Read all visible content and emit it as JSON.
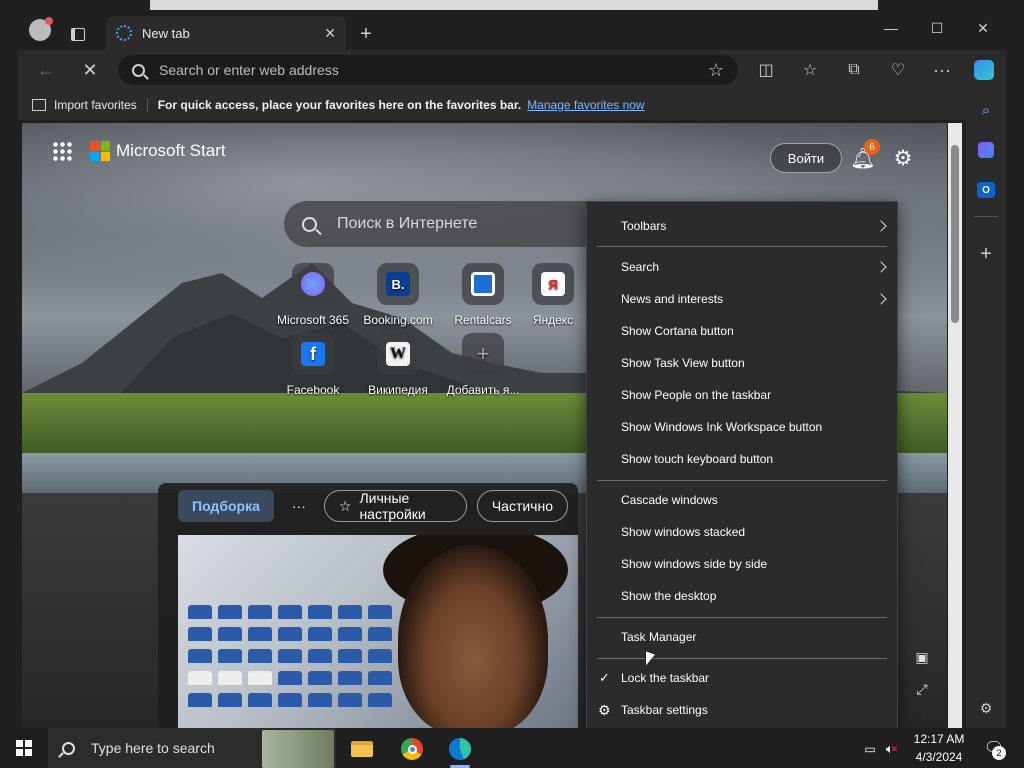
{
  "browser": {
    "tab_title": "New tab",
    "address_placeholder": "Search or enter web address",
    "favbar": {
      "import_label": "Import favorites",
      "hint": "For quick access, place your favorites here on the favorites bar.",
      "manage_link": "Manage favorites now"
    }
  },
  "newtab": {
    "brand": "Microsoft Start",
    "login_label": "Войти",
    "notif_count": "6",
    "search_placeholder": "Поиск в Интернете",
    "tiles": [
      {
        "label": "Microsoft 365"
      },
      {
        "label": "Booking.com",
        "glyph": "B."
      },
      {
        "label": "Rentalcars"
      },
      {
        "label": "Яндекс",
        "glyph": "Я"
      },
      {
        "label": "Facebook",
        "glyph": "f"
      },
      {
        "label": "Википедия",
        "glyph": "W"
      },
      {
        "label": "Добавить я...",
        "glyph": "+"
      }
    ],
    "feed_tabs": {
      "selected": "Подборка",
      "more": "···",
      "personal": "Личные настройки",
      "partial": "Частично"
    }
  },
  "context_menu": {
    "toolbars": "Toolbars",
    "search": "Search",
    "news": "News and interests",
    "cortana": "Show Cortana button",
    "task_view": "Show Task View button",
    "people": "Show People on the taskbar",
    "ink": "Show Windows Ink Workspace button",
    "touch_kb": "Show touch keyboard button",
    "cascade": "Cascade windows",
    "stacked": "Show windows stacked",
    "side_by_side": "Show windows side by side",
    "desktop": "Show the desktop",
    "task_manager": "Task Manager",
    "lock": "Lock the taskbar",
    "settings": "Taskbar settings"
  },
  "taskbar": {
    "search_placeholder": "Type here to search",
    "time": "12:17 AM",
    "date": "4/3/2024",
    "notif_count": "2"
  },
  "colors": {
    "accent": "#4ea1ff",
    "link": "#7fb8ff",
    "badge": "#e8631a"
  }
}
